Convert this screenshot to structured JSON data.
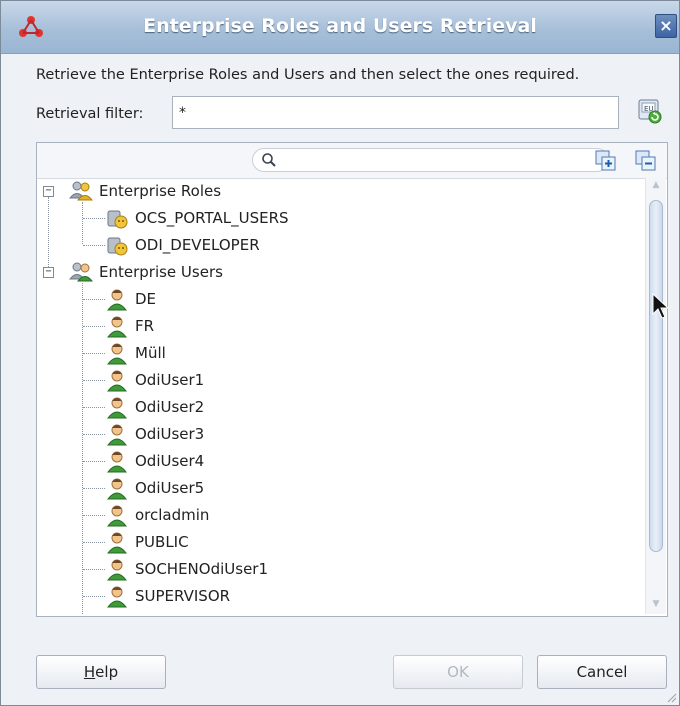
{
  "window": {
    "title": "Enterprise Roles and Users Retrieval",
    "close_glyph": "×"
  },
  "instruction": "Retrieve the Enterprise Roles and Users and then select the ones required.",
  "filter": {
    "label": "Retrieval filter:",
    "value": "*"
  },
  "search": {
    "placeholder": ""
  },
  "tree": {
    "roles_group": {
      "label": "Enterprise Roles",
      "expanded": true,
      "items": [
        {
          "label": "OCS_PORTAL_USERS"
        },
        {
          "label": "ODI_DEVELOPER"
        }
      ]
    },
    "users_group": {
      "label": "Enterprise Users",
      "expanded": true,
      "items": [
        {
          "label": "DE"
        },
        {
          "label": "FR"
        },
        {
          "label": "Müll"
        },
        {
          "label": "OdiUser1"
        },
        {
          "label": "OdiUser2"
        },
        {
          "label": "OdiUser3"
        },
        {
          "label": "OdiUser4"
        },
        {
          "label": "OdiUser5"
        },
        {
          "label": "orcladmin"
        },
        {
          "label": "PUBLIC"
        },
        {
          "label": "SOCHENOdiUser1"
        },
        {
          "label": "SUPERVISOR"
        }
      ]
    }
  },
  "buttons": {
    "help": "Help",
    "ok": "OK",
    "cancel": "Cancel",
    "ok_enabled": false
  },
  "icons": {
    "app": "oracle-app-icon",
    "close": "close-icon",
    "retrieve": "retrieve-icon",
    "search": "search-icon",
    "expand_all": "expand-all-icon",
    "collapse_all": "collapse-all-icon",
    "role_group": "roles-group-icon",
    "role": "role-icon",
    "user_group": "users-group-icon",
    "user": "user-icon"
  },
  "colors": {
    "title_bar": "#a7bfd9",
    "title_text": "#ffffff",
    "user_icon_green": "#3f9b3a",
    "role_icon_gold": "#e6b422"
  }
}
